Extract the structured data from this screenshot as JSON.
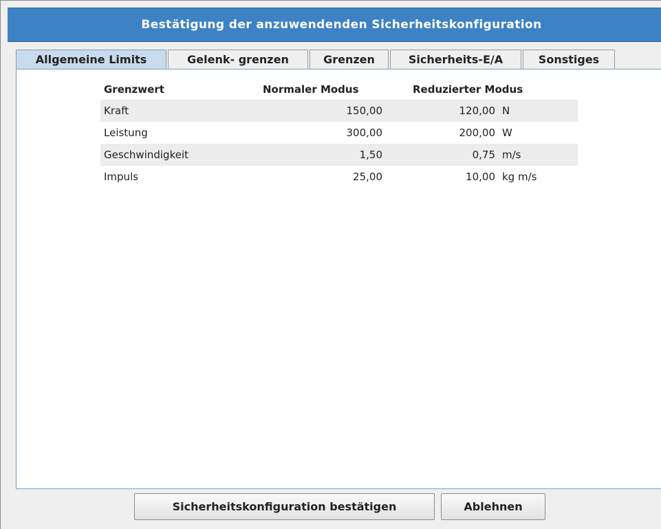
{
  "dialog": {
    "title": "Bestätigung der anzuwendenden Sicherheitskonfiguration"
  },
  "tabs": [
    {
      "label": "Allgemeine Limits",
      "active": true
    },
    {
      "label": "Gelenk- grenzen",
      "active": false
    },
    {
      "label": "Grenzen",
      "active": false
    },
    {
      "label": "Sicherheits-E/A",
      "active": false
    },
    {
      "label": "Sonstiges",
      "active": false
    }
  ],
  "table": {
    "headers": {
      "name": "Grenzwert",
      "normal": "Normaler Modus",
      "reduced": "Reduzierter Modus"
    },
    "rows": [
      {
        "name": "Kraft",
        "normal": "150,00",
        "reduced": "120,00",
        "unit": "N"
      },
      {
        "name": "Leistung",
        "normal": "300,00",
        "reduced": "200,00",
        "unit": "W"
      },
      {
        "name": "Geschwindigkeit",
        "normal": "1,50",
        "reduced": "0,75",
        "unit": "m/s"
      },
      {
        "name": "Impuls",
        "normal": "25,00",
        "reduced": "10,00",
        "unit": "kg m/s"
      }
    ]
  },
  "buttons": {
    "confirm": "Sicherheitskonfiguration bestätigen",
    "reject": "Ablehnen"
  }
}
